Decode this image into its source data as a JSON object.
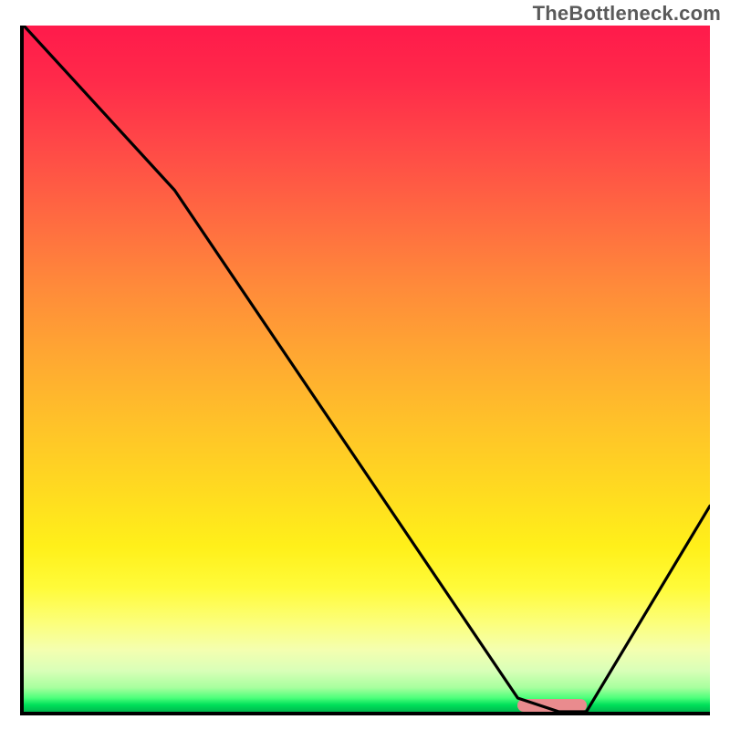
{
  "attribution": "TheBottleneck.com",
  "chart_data": {
    "type": "line",
    "title": "",
    "xlabel": "",
    "ylabel": "",
    "xlim": [
      0,
      100
    ],
    "ylim": [
      0,
      100
    ],
    "grid": false,
    "series": [
      {
        "name": "bottleneck-curve",
        "x": [
          0,
          22,
          72,
          78,
          82,
          100
        ],
        "values": [
          100,
          76,
          2,
          0,
          0,
          30
        ]
      }
    ],
    "markers": [
      {
        "name": "target-range",
        "type": "segment",
        "x_start": 72,
        "x_end": 82,
        "y": 0,
        "color": "#e98b8e"
      }
    ],
    "background": {
      "type": "vertical-gradient",
      "stops": [
        {
          "pos": 0,
          "color": "#ff1a4b"
        },
        {
          "pos": 50,
          "color": "#ffa732"
        },
        {
          "pos": 78,
          "color": "#fff01a"
        },
        {
          "pos": 100,
          "color": "#00b94e"
        }
      ]
    }
  }
}
